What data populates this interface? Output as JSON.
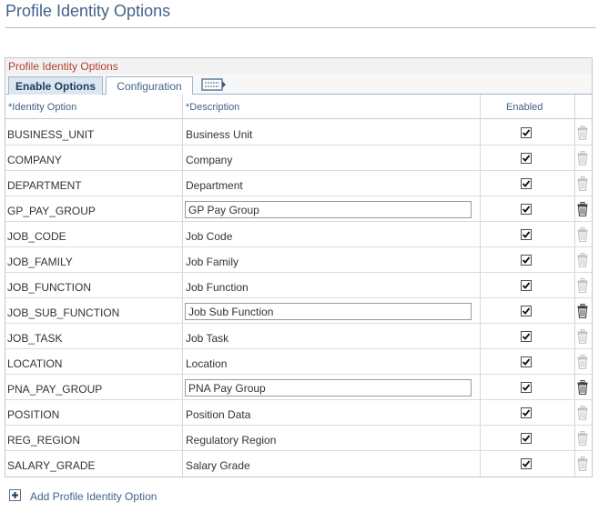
{
  "page": {
    "title": "Profile Identity Options"
  },
  "grid": {
    "title": "Profile Identity Options",
    "tabs": [
      {
        "label": "Enable Options",
        "active": true
      },
      {
        "label": "Configuration",
        "active": false
      }
    ],
    "show_all_columns_icon": "show-all-columns-icon",
    "columns": {
      "identity_option": "*Identity Option",
      "description": "*Description",
      "enabled": "Enabled"
    },
    "rows": [
      {
        "code": "BUSINESS_UNIT",
        "description": "Business Unit",
        "editable": false,
        "enabled": true,
        "delete_active": false
      },
      {
        "code": "COMPANY",
        "description": "Company",
        "editable": false,
        "enabled": true,
        "delete_active": false
      },
      {
        "code": "DEPARTMENT",
        "description": "Department",
        "editable": false,
        "enabled": true,
        "delete_active": false
      },
      {
        "code": "GP_PAY_GROUP",
        "description": "GP Pay Group",
        "editable": true,
        "enabled": true,
        "delete_active": true
      },
      {
        "code": "JOB_CODE",
        "description": "Job Code",
        "editable": false,
        "enabled": true,
        "delete_active": false
      },
      {
        "code": "JOB_FAMILY",
        "description": "Job Family",
        "editable": false,
        "enabled": true,
        "delete_active": false
      },
      {
        "code": "JOB_FUNCTION",
        "description": "Job Function",
        "editable": false,
        "enabled": true,
        "delete_active": false
      },
      {
        "code": "JOB_SUB_FUNCTION",
        "description": "Job Sub Function",
        "editable": true,
        "enabled": true,
        "delete_active": true
      },
      {
        "code": "JOB_TASK",
        "description": "Job Task",
        "editable": false,
        "enabled": true,
        "delete_active": false
      },
      {
        "code": "LOCATION",
        "description": "Location",
        "editable": false,
        "enabled": true,
        "delete_active": false
      },
      {
        "code": "PNA_PAY_GROUP",
        "description": "PNA Pay Group",
        "editable": true,
        "enabled": true,
        "delete_active": true
      },
      {
        "code": "POSITION",
        "description": "Position Data",
        "editable": false,
        "enabled": true,
        "delete_active": false
      },
      {
        "code": "REG_REGION",
        "description": "Regulatory Region",
        "editable": false,
        "enabled": true,
        "delete_active": false
      },
      {
        "code": "SALARY_GRADE",
        "description": "Salary Grade",
        "editable": false,
        "enabled": true,
        "delete_active": false
      }
    ]
  },
  "add_link": {
    "label": "Add Profile Identity Option",
    "icon": "plus-icon"
  },
  "colors": {
    "title": "#42638b",
    "grid_title": "#b3402a",
    "trash_active": "#444444",
    "trash_inactive": "#c4c4c4"
  }
}
